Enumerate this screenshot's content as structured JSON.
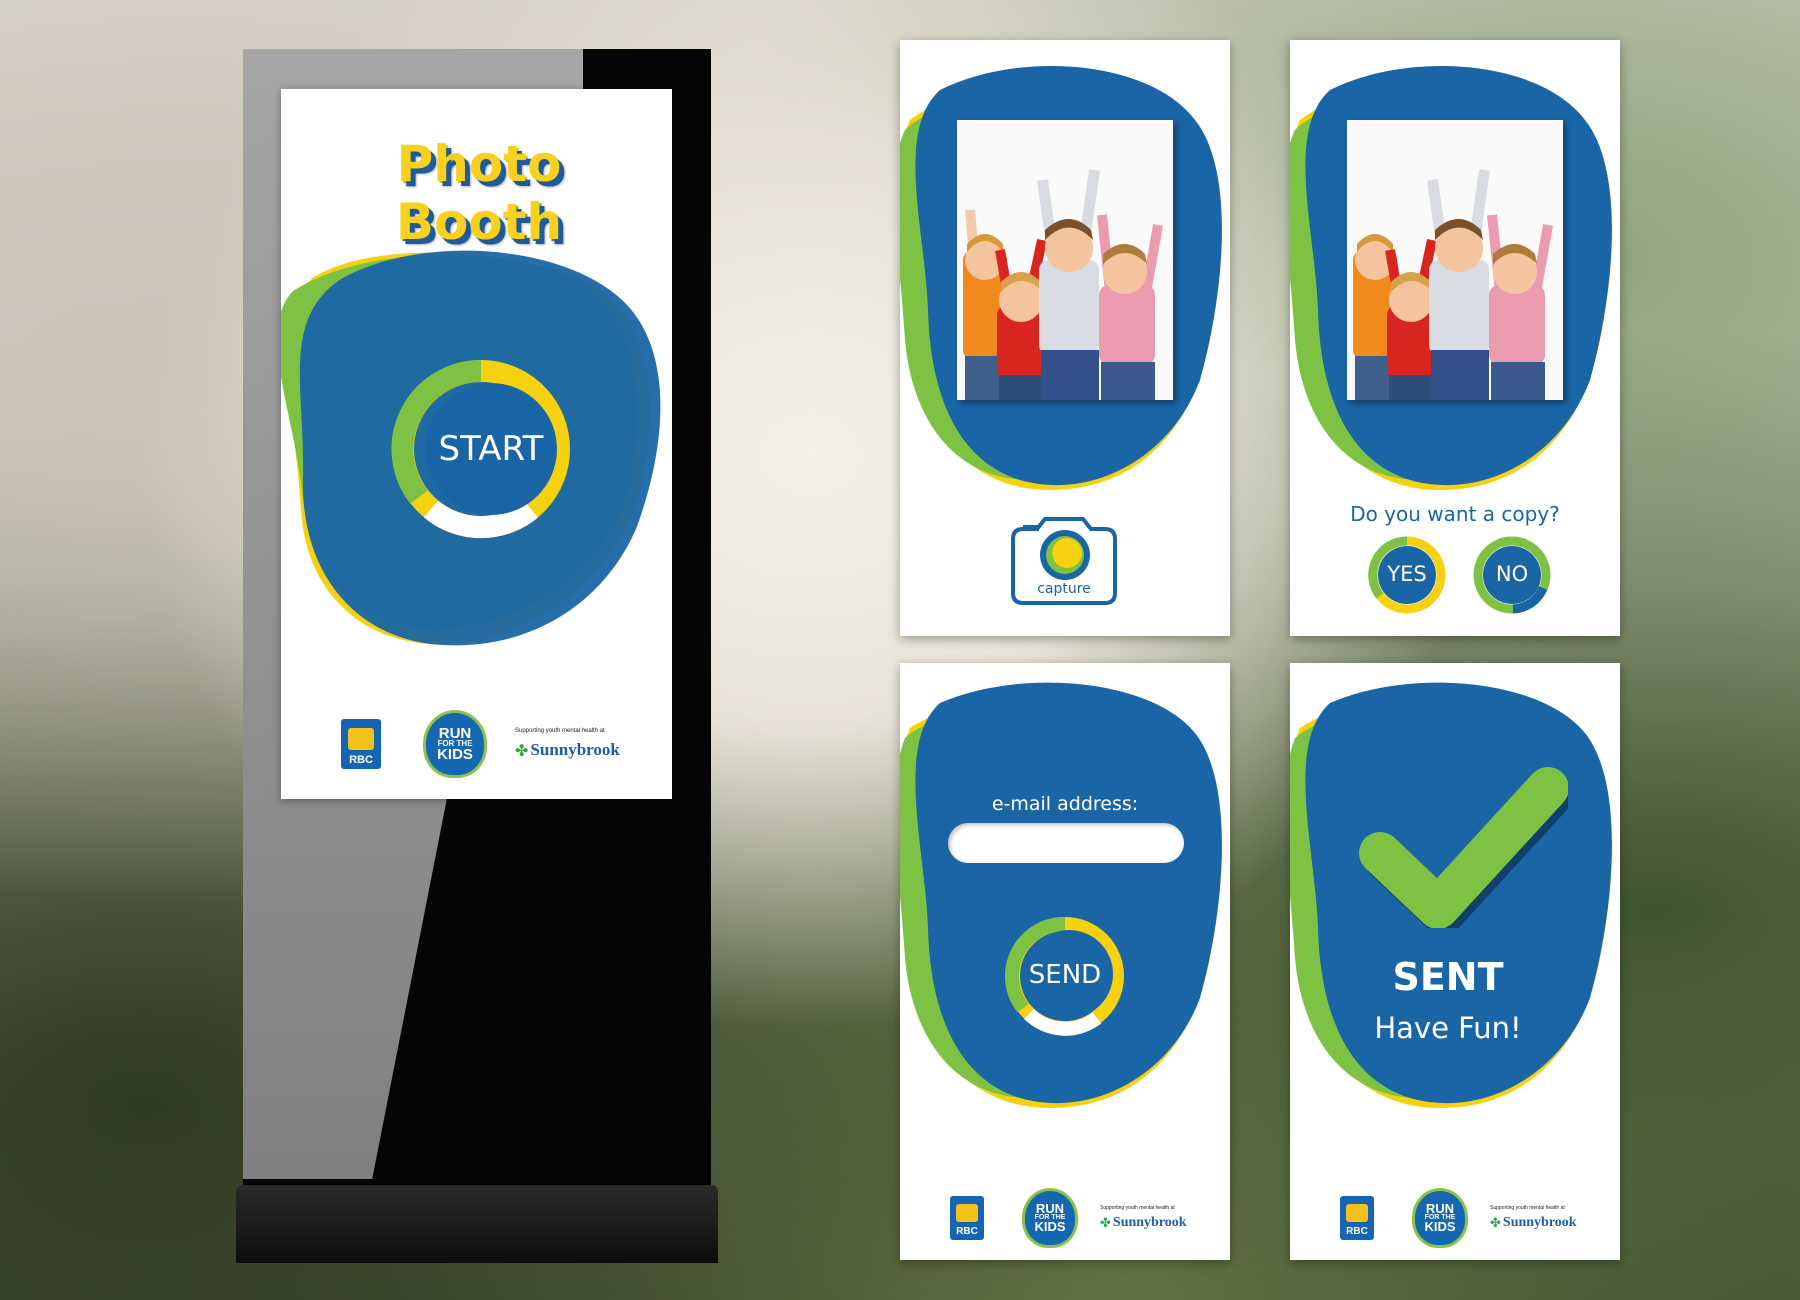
{
  "kiosk": {
    "title": "Photo Booth",
    "start_label": "START"
  },
  "logos": {
    "rbc": "RBC",
    "run_line1": "RUN",
    "run_line2": "FOR THE",
    "run_line3": "KIDS",
    "supporting": "Supporting youth mental health at",
    "sunnybrook": "Sunnybrook"
  },
  "capture_screen": {
    "capture_label": "capture"
  },
  "copy_screen": {
    "question": "Do you want a copy?",
    "yes_label": "YES",
    "no_label": "NO"
  },
  "email_screen": {
    "email_label": "e-mail address:",
    "email_value": "",
    "send_label": "SEND"
  },
  "sent_screen": {
    "sent_label": "SENT",
    "fun_label": "Have Fun!"
  },
  "colors": {
    "blue": "#1a65a6",
    "green": "#7dc242",
    "yellow": "#f5d10f"
  }
}
